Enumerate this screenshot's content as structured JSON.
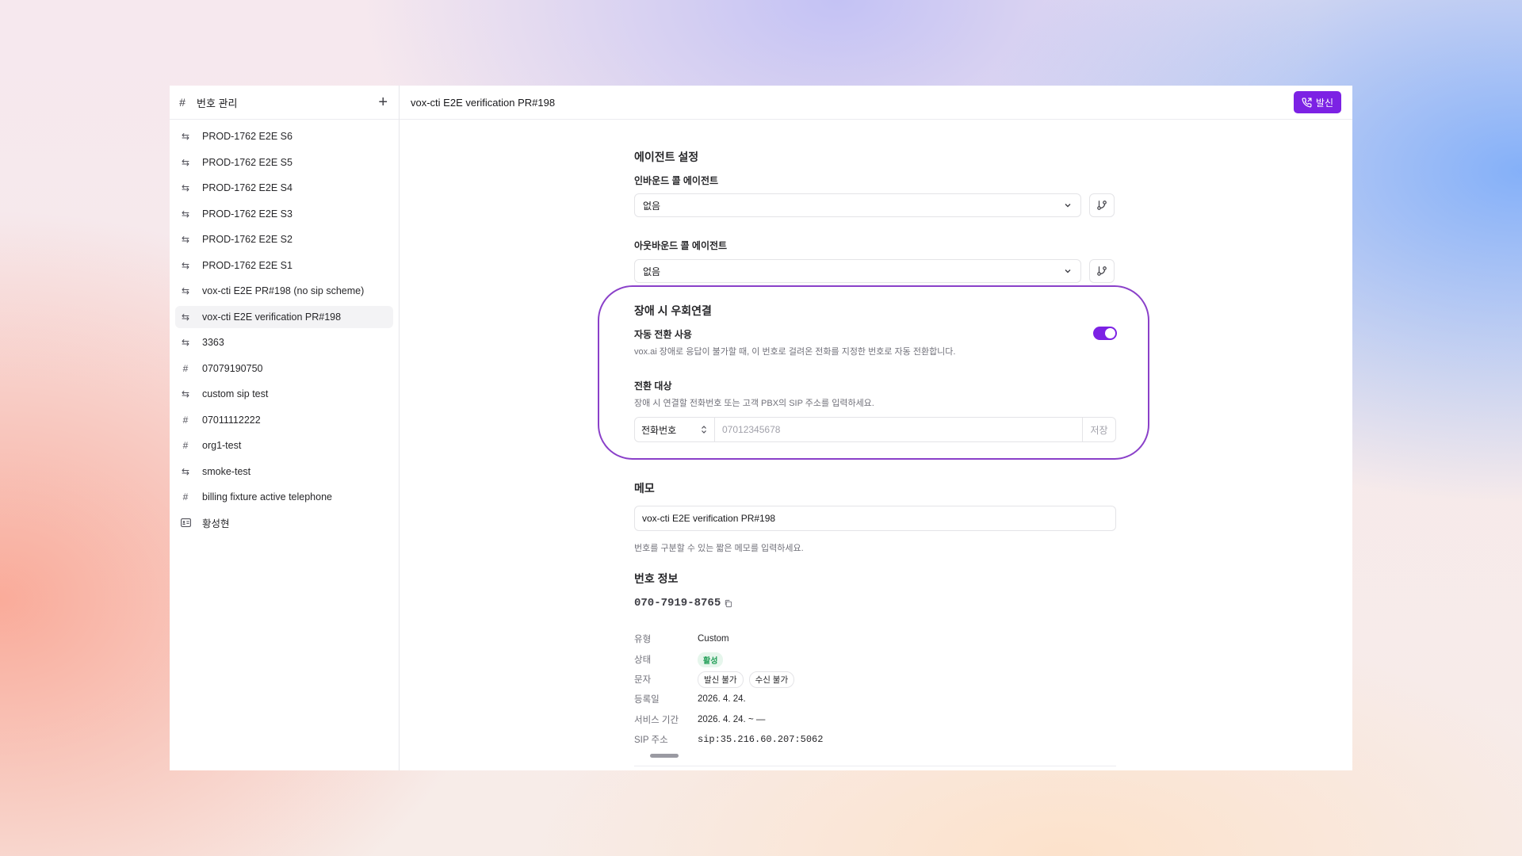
{
  "sidebar": {
    "title": "번호 관리",
    "items": [
      {
        "label": "PROD-1762 E2E S6",
        "icon": "arrows-icon"
      },
      {
        "label": "PROD-1762 E2E S5",
        "icon": "arrows-icon"
      },
      {
        "label": "PROD-1762 E2E S4",
        "icon": "arrows-icon"
      },
      {
        "label": "PROD-1762 E2E S3",
        "icon": "arrows-icon"
      },
      {
        "label": "PROD-1762 E2E S2",
        "icon": "arrows-icon"
      },
      {
        "label": "PROD-1762 E2E S1",
        "icon": "arrows-icon"
      },
      {
        "label": "vox-cti E2E PR#198 (no sip scheme)",
        "icon": "arrows-icon"
      },
      {
        "label": "vox-cti E2E verification PR#198",
        "icon": "arrows-icon",
        "active": true
      },
      {
        "label": "3363",
        "icon": "arrows-icon"
      },
      {
        "label": "07079190750",
        "icon": "hash-icon"
      },
      {
        "label": "custom sip test",
        "icon": "arrows-icon"
      },
      {
        "label": "07011112222",
        "icon": "hash-icon"
      },
      {
        "label": "org1-test",
        "icon": "hash-icon"
      },
      {
        "label": "smoke-test",
        "icon": "arrows-icon"
      },
      {
        "label": "billing fixture active telephone",
        "icon": "hash-icon"
      },
      {
        "label": "황성현",
        "icon": "id-card-icon"
      }
    ]
  },
  "header": {
    "title": "vox-cti E2E verification PR#198",
    "call_button": "발신"
  },
  "agent_settings": {
    "title": "에이전트 설정",
    "inbound_label": "인바운드 콜 에이전트",
    "inbound_value": "없음",
    "outbound_label": "아웃바운드 콜 에이전트",
    "outbound_value": "없음"
  },
  "failover": {
    "title": "장애 시 우회연결",
    "auto_label": "자동 전환 사용",
    "auto_desc": "vox.ai 장애로 응답이 불가할 때, 이 번호로 걸려온 전화를 지정한 번호로 자동 전환합니다.",
    "auto_enabled": true,
    "target_label": "전환 대상",
    "target_desc": "장애 시 연결할 전화번호 또는 고객 PBX의 SIP 주소를 입력하세요.",
    "target_type": "전화번호",
    "target_placeholder": "07012345678",
    "save_label": "저장"
  },
  "memo": {
    "title": "메모",
    "value": "vox-cti E2E verification PR#198",
    "hint": "번호를 구분할 수 있는 짧은 메모를 입력하세요."
  },
  "number_info": {
    "title": "번호 정보",
    "phone": "070-7919-8765",
    "type_key": "유형",
    "type_value": "Custom",
    "status_key": "상태",
    "status_value": "활성",
    "sms_key": "문자",
    "sms_out": "발신 불가",
    "sms_in": "수신 불가",
    "registered_key": "등록일",
    "registered_value": "2026. 4. 24.",
    "period_key": "서비스 기간",
    "period_value": "2026. 4. 24. ~ —",
    "sip_key": "SIP 주소",
    "sip_value": "sip:35.216.60.207:5062"
  },
  "colors": {
    "accent": "#7c22e4",
    "highlight_ring": "#8a40c9",
    "status_green": "#1f9d55"
  }
}
